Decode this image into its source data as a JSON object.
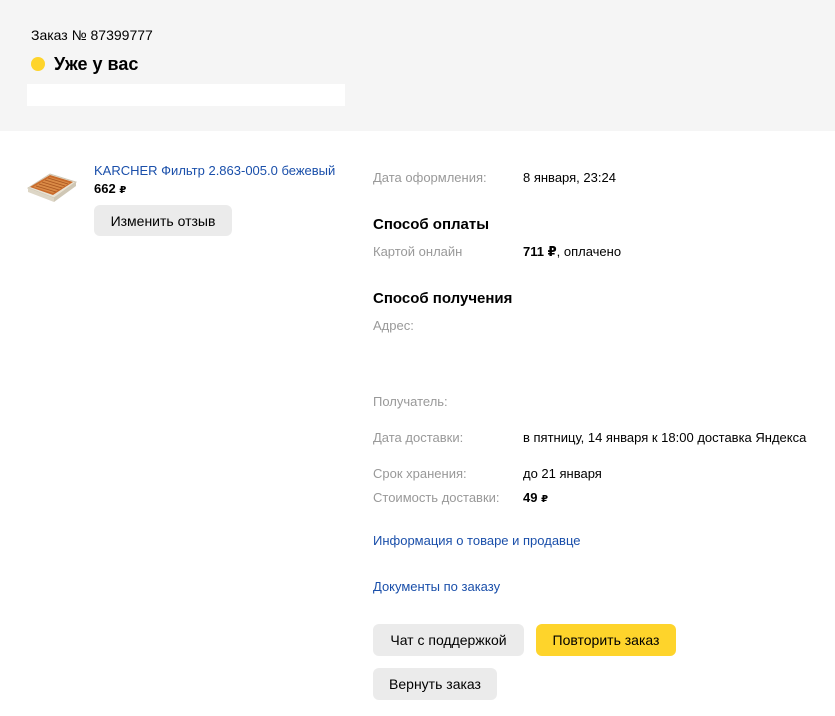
{
  "header": {
    "order_number": "Заказ № 87399777",
    "status": "Уже у вас",
    "status_color": "#fed42b"
  },
  "product": {
    "title": "KARCHER Фильтр 2.863-005.0 бежевый",
    "price": "662",
    "currency": "₽",
    "thumbnail_icon": "air-filter-icon",
    "review_button": "Изменить отзыв"
  },
  "details": {
    "order_date_label": "Дата оформления:",
    "order_date_value": "8 января, 23:24",
    "payment_title": "Способ оплаты",
    "payment_label": "Картой онлайн",
    "payment_amount": "711 ₽",
    "payment_status": ", оплачено",
    "delivery_title": "Способ получения",
    "address_label": "Адрес:",
    "recipient_label": "Получатель:",
    "delivery_date_label": "Дата доставки:",
    "delivery_date_value": "в пятницу, 14 января к 18:00 доставка Яндекса",
    "storage_label": "Срок хранения:",
    "storage_value": "до 21 января",
    "delivery_cost_label": "Стоимость доставки:",
    "delivery_cost_value": "49",
    "currency": "₽"
  },
  "links": {
    "product_info": "Информация о товаре и продавце",
    "documents": "Документы по заказу"
  },
  "actions": {
    "support_chat": "Чат с поддержкой",
    "repeat_order": "Повторить заказ",
    "return_order": "Вернуть заказ"
  },
  "colors": {
    "accent_yellow": "#fed42b",
    "link_blue": "#1a4faa",
    "muted_gray": "#999999",
    "button_gray": "#ebebeb",
    "header_bg": "#f5f5f5"
  }
}
